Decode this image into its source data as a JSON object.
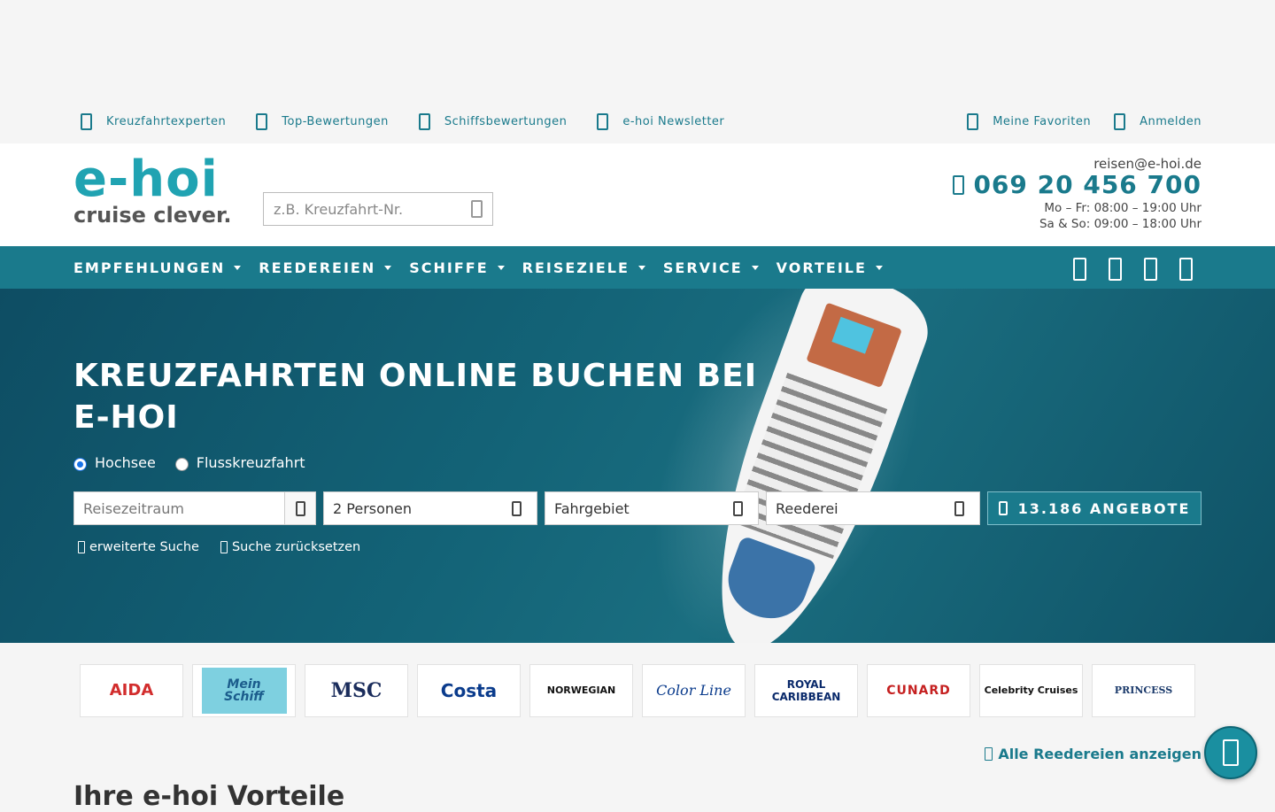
{
  "toplinks": {
    "left": [
      "Kreuzfahrtexperten",
      "Top-Bewertungen",
      "Schiffsbewertungen",
      "e-hoi Newsletter"
    ],
    "right": [
      "Meine Favoriten",
      "Anmelden"
    ]
  },
  "logo": {
    "name": "e-hoi",
    "tagline": "cruise clever."
  },
  "search": {
    "placeholder": "z.B. Kreuzfahrt-Nr."
  },
  "contact": {
    "email": "reisen@e-hoi.de",
    "phone": "069 20 456 700",
    "hours1": "Mo – Fr: 08:00 – 19:00 Uhr",
    "hours2": "Sa & So: 09:00 – 18:00 Uhr"
  },
  "nav": [
    "EMPFEHLUNGEN",
    "REEDEREIEN",
    "SCHIFFE",
    "REISEZIELE",
    "SERVICE",
    "VORTEILE"
  ],
  "hero": {
    "title": "KREUZFAHRTEN ONLINE BUCHEN BEI E-HOI",
    "radio1": "Hochsee",
    "radio2": "Flusskreuzfahrt",
    "date_placeholder": "Reisezeitraum",
    "persons": "2 Personen",
    "region": "Fahrgebiet",
    "line": "Reederei",
    "offers": "13.186 ANGEBOTE",
    "ext": "erweiterte Suche",
    "reset": "Suche zurücksetzen"
  },
  "logos": [
    {
      "name": "AIDA",
      "color": "#d22d2d"
    },
    {
      "name": "Mein Schiff",
      "color": "#1b5c8c"
    },
    {
      "name": "MSC",
      "color": "#1b2d5c"
    },
    {
      "name": "Costa",
      "color": "#0a3b8c"
    },
    {
      "name": "NORWEGIAN",
      "color": "#111"
    },
    {
      "name": "Color Line",
      "color": "#0a3b8c"
    },
    {
      "name": "ROYAL CARIBBEAN",
      "color": "#0a2a6b"
    },
    {
      "name": "CUNARD",
      "color": "#c52020"
    },
    {
      "name": "Celebrity Cruises",
      "color": "#111"
    },
    {
      "name": "PRINCESS",
      "color": "#1b3a6b"
    }
  ],
  "all_lines": "Alle Reedereien anzeigen",
  "section_title": "Ihre e-hoi Vorteile"
}
